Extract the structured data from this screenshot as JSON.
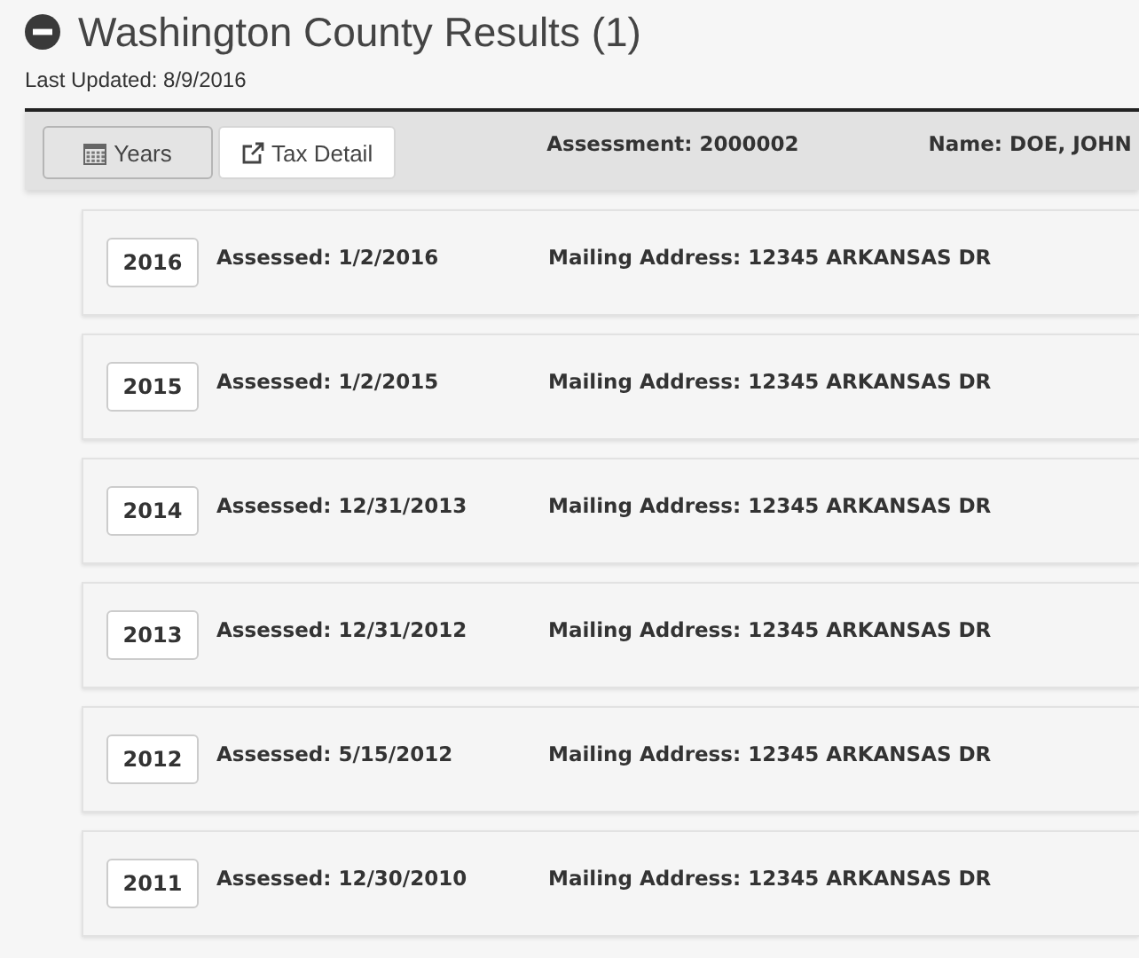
{
  "header": {
    "title": "Washington County Results (1)",
    "last_updated": "Last Updated: 8/9/2016"
  },
  "toolbar": {
    "buttons": [
      {
        "kind": "calendar",
        "label": "Years",
        "selected": true
      },
      {
        "kind": "external",
        "label": "Tax Detail",
        "selected": false
      }
    ],
    "assessment": "Assessment: 2000002",
    "name": "Name: DOE, JOHN"
  },
  "years": [
    {
      "year": "2016",
      "assessed": "Assessed: 1/2/2016",
      "address": "Mailing Address: 12345 ARKANSAS DR"
    },
    {
      "year": "2015",
      "assessed": "Assessed: 1/2/2015",
      "address": "Mailing Address: 12345 ARKANSAS DR"
    },
    {
      "year": "2014",
      "assessed": "Assessed: 12/31/2013",
      "address": "Mailing Address: 12345 ARKANSAS DR"
    },
    {
      "year": "2013",
      "assessed": "Assessed: 12/31/2012",
      "address": "Mailing Address: 12345 ARKANSAS DR"
    },
    {
      "year": "2012",
      "assessed": "Assessed: 5/15/2012",
      "address": "Mailing Address: 12345 ARKANSAS DR"
    },
    {
      "year": "2011",
      "assessed": "Assessed: 12/30/2010",
      "address": "Mailing Address: 12345 ARKANSAS DR"
    }
  ]
}
